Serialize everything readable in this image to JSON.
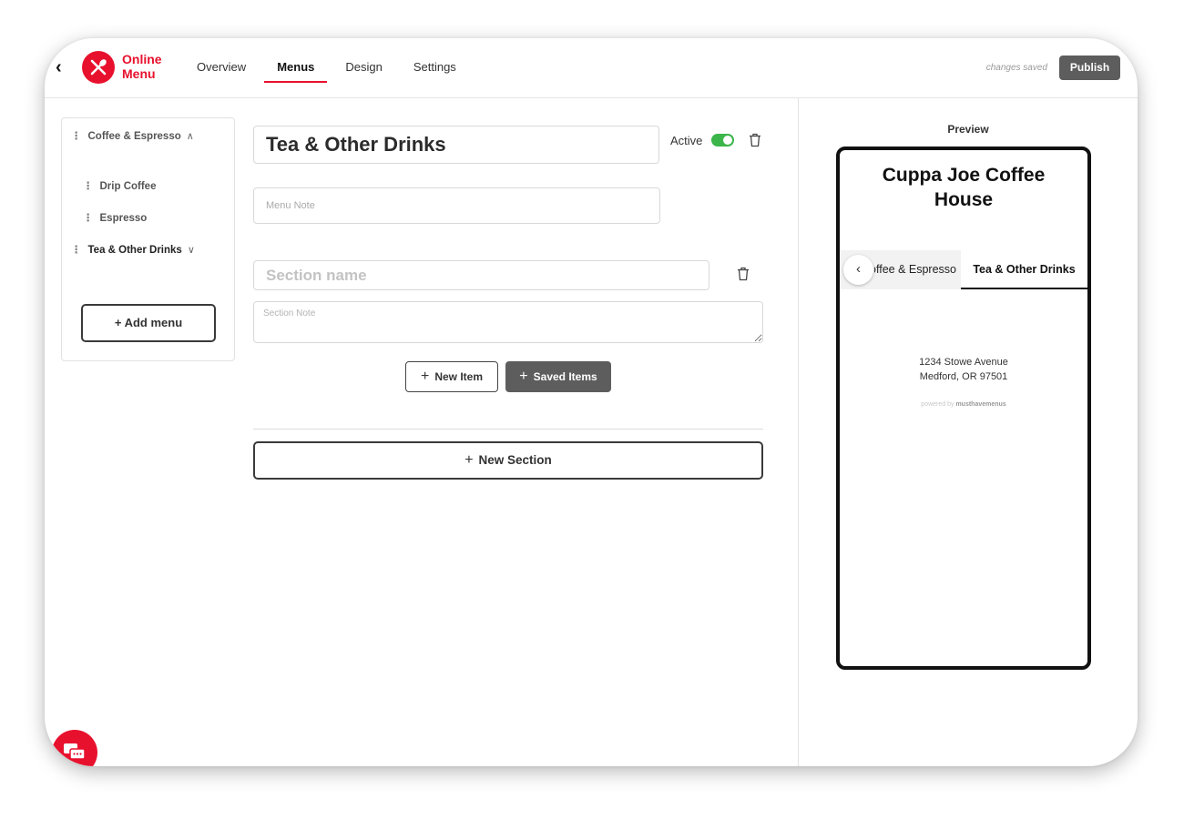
{
  "header": {
    "back_icon": "back-chevron-icon",
    "logo_icon": "fork-knife-icon",
    "logo_line1": "Online",
    "logo_line2": "Menu",
    "tabs": [
      {
        "label": "Overview",
        "active": false
      },
      {
        "label": "Menus",
        "active": true
      },
      {
        "label": "Design",
        "active": false
      },
      {
        "label": "Settings",
        "active": false
      }
    ],
    "status": "changes saved",
    "publish_label": "Publish",
    "brand_color": "#e8112d"
  },
  "sidebar": {
    "items": [
      {
        "label": "Coffee & Espresso",
        "chevron": "∧"
      },
      {
        "label": "Drip Coffee"
      },
      {
        "label": "Espresso"
      },
      {
        "label": "Tea & Other Drinks",
        "chevron": "∨"
      }
    ],
    "add_menu_label": "+ Add menu"
  },
  "editor": {
    "menu_title": "Tea & Other Drinks",
    "active_label": "Active",
    "active": true,
    "toggle_color": "#3cb54a",
    "menu_note_placeholder": "Menu Note",
    "section_name_placeholder": "Section name",
    "section_note_placeholder": "Section Note",
    "new_item_label": "New Item",
    "saved_items_label": "Saved Items",
    "new_section_label": "New Section"
  },
  "preview": {
    "label": "Preview",
    "restaurant_name": "Cuppa Joe Coffee House",
    "tabs": [
      "Coffee & Espresso",
      "Tea & Other Drinks"
    ],
    "active_tab": "Tea & Other Drinks",
    "address_line1": "1234 Stowe Avenue",
    "address_line2": "Medford, OR 97501",
    "powered_prefix": "powered by",
    "powered_brand": "musthavemenus"
  },
  "chat": {
    "icon": "chat-bubbles-icon"
  }
}
